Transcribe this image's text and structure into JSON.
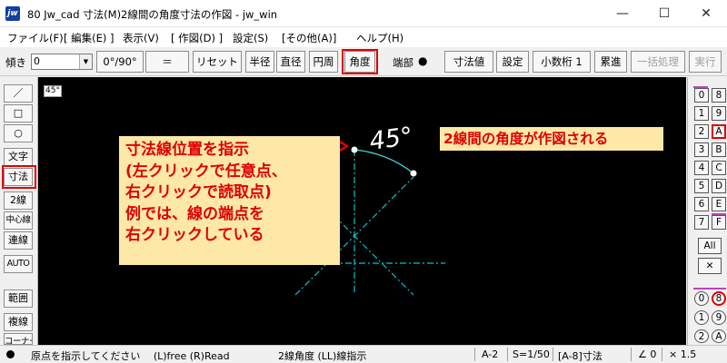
{
  "window": {
    "icon_text": "jw",
    "title": "80 Jw_cad 寸法(M)2線間の角度寸法の作図 - jw_win",
    "minimize": "—",
    "maximize": "☐",
    "close": "✕"
  },
  "menu": [
    "ファイル(F)",
    "[ 編集(E) ]",
    "表示(V)",
    "[ 作図(D) ]",
    "設定(S)",
    "[その他(A)]",
    "ヘルプ(H)"
  ],
  "toolbar": {
    "tilt_label": "傾き",
    "tilt_value": "0",
    "buttons": [
      "0°/90°",
      "＝",
      "リセット",
      "半径",
      "直径",
      "円周",
      "角度"
    ],
    "endpoint_label": "端部",
    "endpoint_dot": "●",
    "buttons2": [
      "寸法値",
      "設定",
      "小数桁 1",
      "累進",
      "一括処理",
      "実行"
    ]
  },
  "left_tools": [
    "／",
    "□",
    "○",
    "文字",
    "寸法",
    "2線",
    "中心線",
    "連線",
    "AUTO",
    "範囲",
    "複線",
    "コーナー"
  ],
  "canvas": {
    "angle_tag": "45°",
    "dimension_text": "45°",
    "note_left": [
      "寸法線位置を指示",
      "(左クリックで任意点、",
      "右クリックで読取点)",
      "例では、線の端点を",
      "右クリックしている"
    ],
    "note_right": "2線間の角度が作図される",
    "colors": {
      "background": "#000000",
      "line": "#00c8c8",
      "arc": "#40e0e0",
      "note_bg": "#fde8a8",
      "note_text": "#e00000",
      "point": "#ffffff"
    }
  },
  "layer_panel": {
    "left_col": [
      "0",
      "1",
      "2",
      "3",
      "4",
      "5",
      "6",
      "7"
    ],
    "right_col": [
      "8",
      "9",
      "A",
      "B",
      "C",
      "D",
      "E",
      "F"
    ],
    "all_label": "All",
    "cross": "✕",
    "group_left": [
      "0",
      "1",
      "2"
    ],
    "group_right": [
      "8",
      "9",
      "A"
    ]
  },
  "status": {
    "dot": "●",
    "message": "原点を指示してください　 (L)free  (R)Read",
    "mode": "2線角度 (LL)線指示",
    "layer": "A-2",
    "scale": "S=1/50",
    "current_layer": "[A-8]寸法",
    "angle": "∠ 0",
    "zoom": "× 1.5"
  }
}
